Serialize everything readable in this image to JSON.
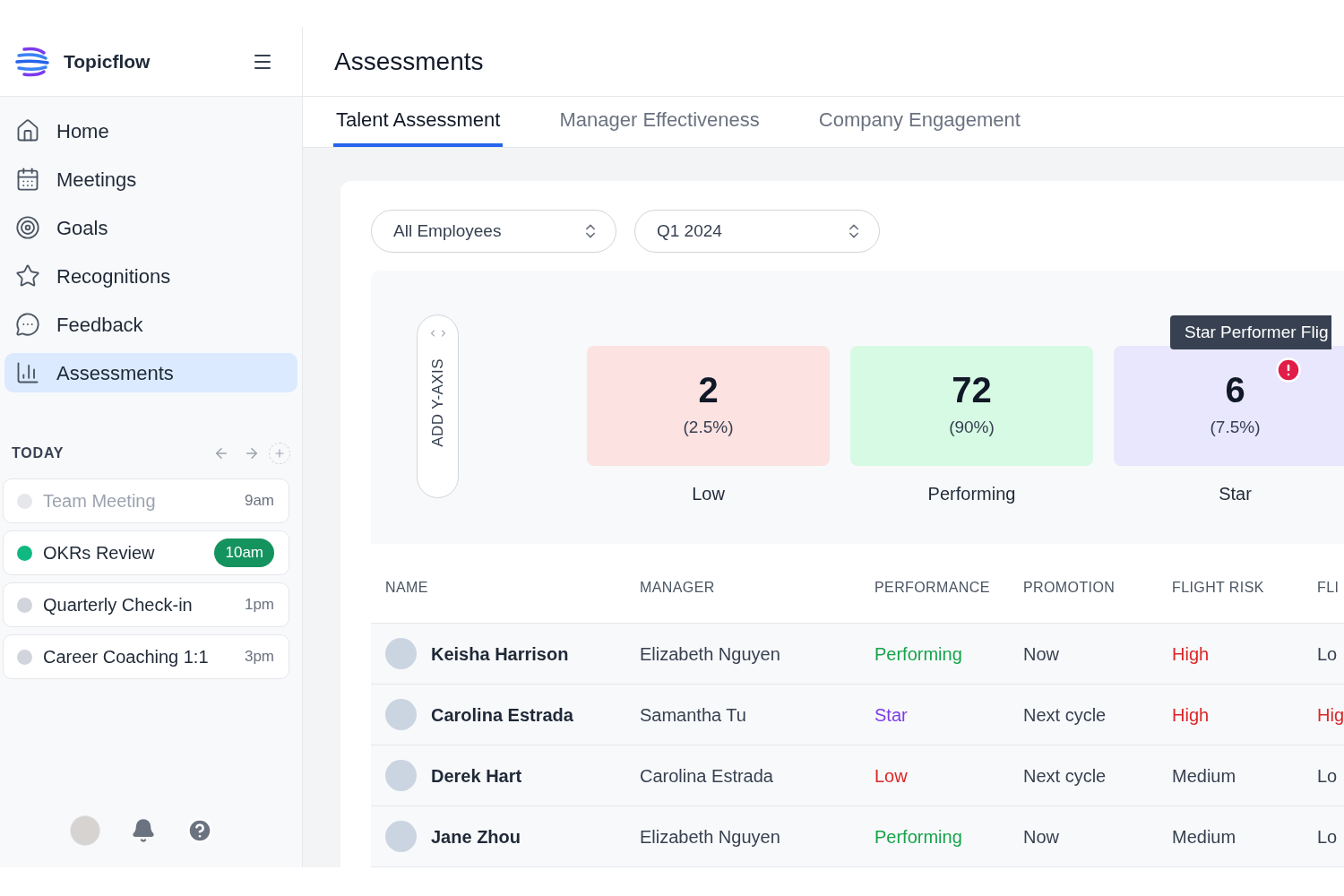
{
  "brand": {
    "name": "Topicflow"
  },
  "nav": [
    {
      "label": "Home",
      "selected": false
    },
    {
      "label": "Meetings",
      "selected": false
    },
    {
      "label": "Goals",
      "selected": false
    },
    {
      "label": "Recognitions",
      "selected": false
    },
    {
      "label": "Feedback",
      "selected": false
    },
    {
      "label": "Assessments",
      "selected": true
    }
  ],
  "today": {
    "title": "TODAY",
    "events": [
      {
        "title": "Team Meeting",
        "time": "9am",
        "kind": "past"
      },
      {
        "title": "OKRs Review",
        "time": "10am",
        "kind": "current"
      },
      {
        "title": "Quarterly Check-in",
        "time": "1pm",
        "kind": "upcoming"
      },
      {
        "title": "Career Coaching 1:1",
        "time": "3pm",
        "kind": "upcoming"
      }
    ]
  },
  "page_title": "Assessments",
  "tabs": [
    {
      "label": "Talent Assessment",
      "selected": true
    },
    {
      "label": "Manager Effectiveness",
      "selected": false
    },
    {
      "label": "Company Engagement",
      "selected": false
    }
  ],
  "filters": [
    {
      "value": "All Employees"
    },
    {
      "value": "Q1 2024"
    }
  ],
  "y_axis_button": "ADD Y-AXIS",
  "tooltip": "Star Performer Flig",
  "buckets": [
    {
      "count": "2",
      "share": "(2.5%)",
      "label": "Low",
      "kind": "low",
      "flagged": false
    },
    {
      "count": "72",
      "share": "(90%)",
      "label": "Performing",
      "kind": "good",
      "flagged": false
    },
    {
      "count": "6",
      "share": "(7.5%)",
      "label": "Star",
      "kind": "star",
      "flagged": true
    }
  ],
  "table": {
    "columns": [
      "NAME",
      "MANAGER",
      "PERFORMANCE",
      "PROMOTION",
      "FLIGHT RISK",
      "FLI"
    ],
    "rows": [
      {
        "cells": [
          {
            "text": "Keisha Harrison",
            "kind": "person"
          },
          {
            "text": "Elizabeth Nguyen",
            "kind": "plain"
          },
          {
            "text": "Performing",
            "kind": "good"
          },
          {
            "text": "Now",
            "kind": "plain"
          },
          {
            "text": "High",
            "kind": "bad"
          },
          {
            "text": "Lo",
            "kind": "plain"
          }
        ]
      },
      {
        "cells": [
          {
            "text": "Carolina Estrada",
            "kind": "person"
          },
          {
            "text": "Samantha Tu",
            "kind": "plain"
          },
          {
            "text": "Star",
            "kind": "star"
          },
          {
            "text": "Next cycle",
            "kind": "plain"
          },
          {
            "text": "High",
            "kind": "bad"
          },
          {
            "text": "Hig",
            "kind": "bad"
          }
        ]
      },
      {
        "cells": [
          {
            "text": "Derek Hart",
            "kind": "person"
          },
          {
            "text": "Carolina Estrada",
            "kind": "plain"
          },
          {
            "text": "Low",
            "kind": "bad"
          },
          {
            "text": "Next cycle",
            "kind": "plain"
          },
          {
            "text": "Medium",
            "kind": "plain"
          },
          {
            "text": "Lo",
            "kind": "plain"
          }
        ]
      },
      {
        "cells": [
          {
            "text": "Jane Zhou",
            "kind": "person"
          },
          {
            "text": "Elizabeth Nguyen",
            "kind": "plain"
          },
          {
            "text": "Performing",
            "kind": "good"
          },
          {
            "text": "Now",
            "kind": "plain"
          },
          {
            "text": "Medium",
            "kind": "plain"
          },
          {
            "text": "Lo",
            "kind": "plain"
          }
        ]
      }
    ]
  }
}
